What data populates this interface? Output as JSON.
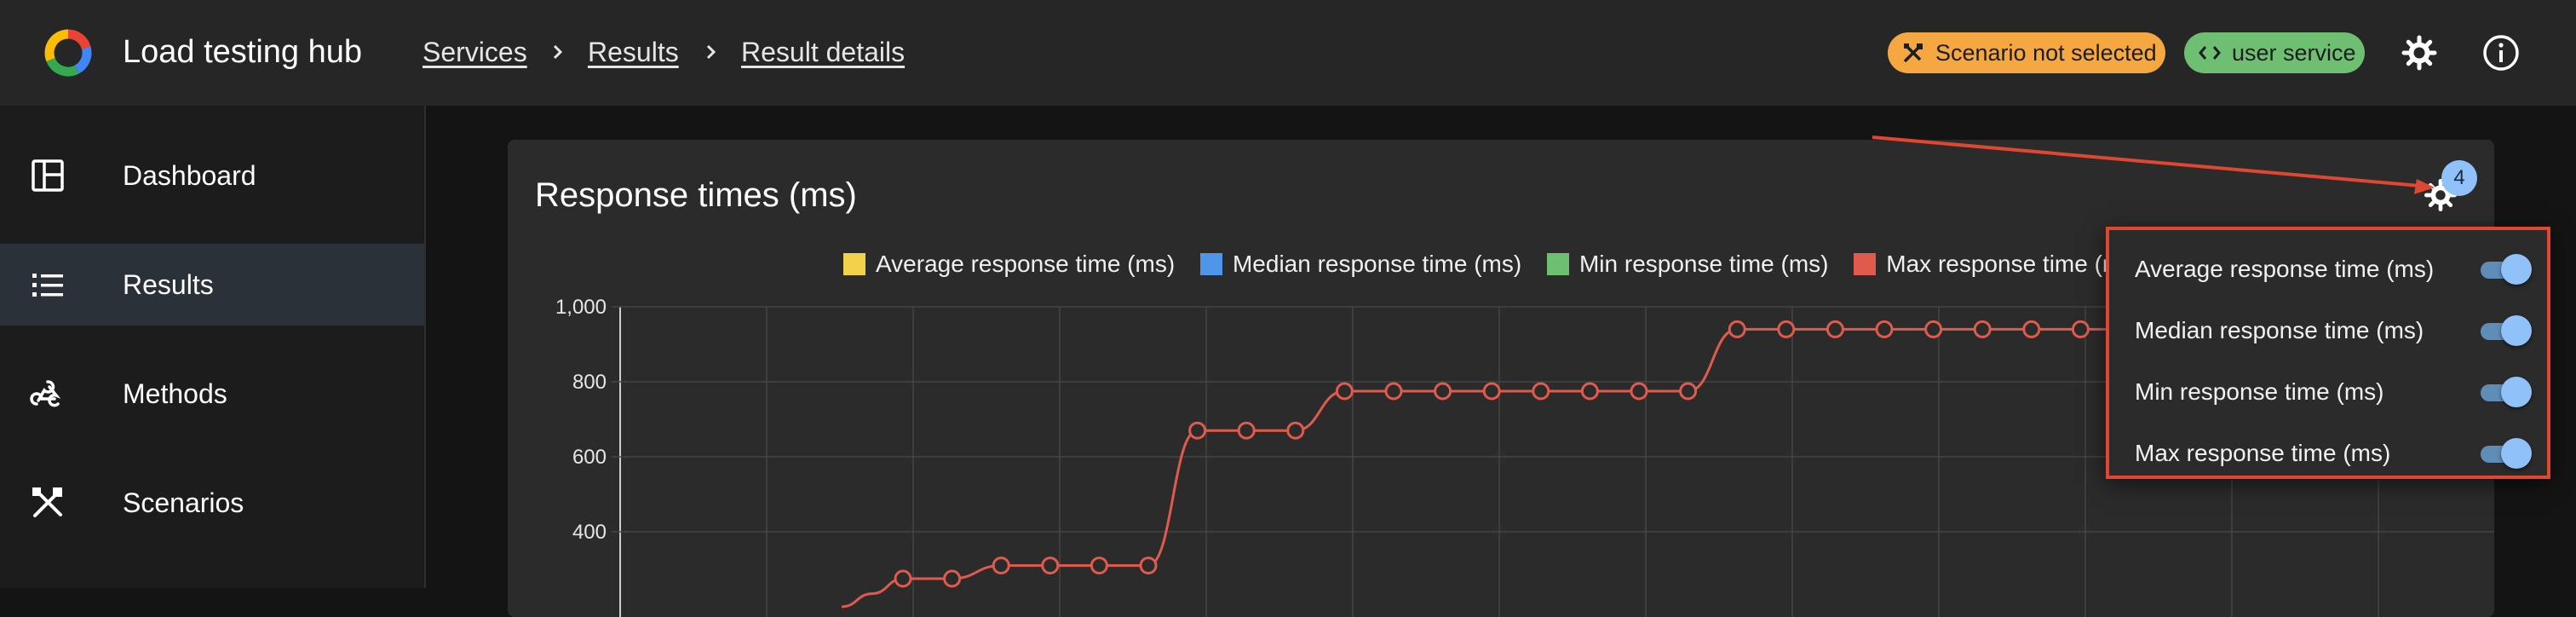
{
  "header": {
    "app_title": "Load testing hub",
    "breadcrumbs": [
      "Services",
      "Results",
      "Result details"
    ],
    "scenario_chip": "Scenario not selected",
    "service_chip": "user service",
    "chip_colors": {
      "scenario": "#f5a742",
      "service": "#6fbf73"
    }
  },
  "sidebar": {
    "items": [
      {
        "label": "Dashboard",
        "icon": "dashboard-icon",
        "active": false
      },
      {
        "label": "Results",
        "icon": "list-icon",
        "active": true
      },
      {
        "label": "Methods",
        "icon": "webhook-icon",
        "active": false
      },
      {
        "label": "Scenarios",
        "icon": "tools-icon",
        "active": false
      }
    ]
  },
  "card": {
    "title": "Response times (ms)",
    "settings_badge": "4"
  },
  "chart_data": {
    "type": "line",
    "title": "",
    "xlabel": "",
    "ylabel": "",
    "ylim": [
      200,
      1000
    ],
    "yticks": [
      "1,000",
      "800",
      "600",
      "400"
    ],
    "legend_position": "top",
    "grid": true,
    "series": [
      {
        "name": "Average response time (ms)",
        "color": "#f2d24b",
        "values": []
      },
      {
        "name": "Median response time (ms)",
        "color": "#4f95e8",
        "values": []
      },
      {
        "name": "Min response time (ms)",
        "color": "#6fbf73",
        "values": []
      },
      {
        "name": "Max response time (ms)",
        "color": "#e05a4e",
        "values": [
          275,
          275,
          310,
          310,
          310,
          310,
          670,
          670,
          670,
          775,
          775,
          775,
          775,
          775,
          775,
          775,
          775,
          940,
          940,
          940,
          940,
          940,
          940,
          940,
          940,
          940,
          940
        ]
      }
    ]
  },
  "settings_popup": {
    "items": [
      {
        "label": "Average response time (ms)",
        "enabled": true
      },
      {
        "label": "Median response time (ms)",
        "enabled": true
      },
      {
        "label": "Min response time (ms)",
        "enabled": true
      },
      {
        "label": "Max response time (ms)",
        "enabled": true
      }
    ]
  }
}
